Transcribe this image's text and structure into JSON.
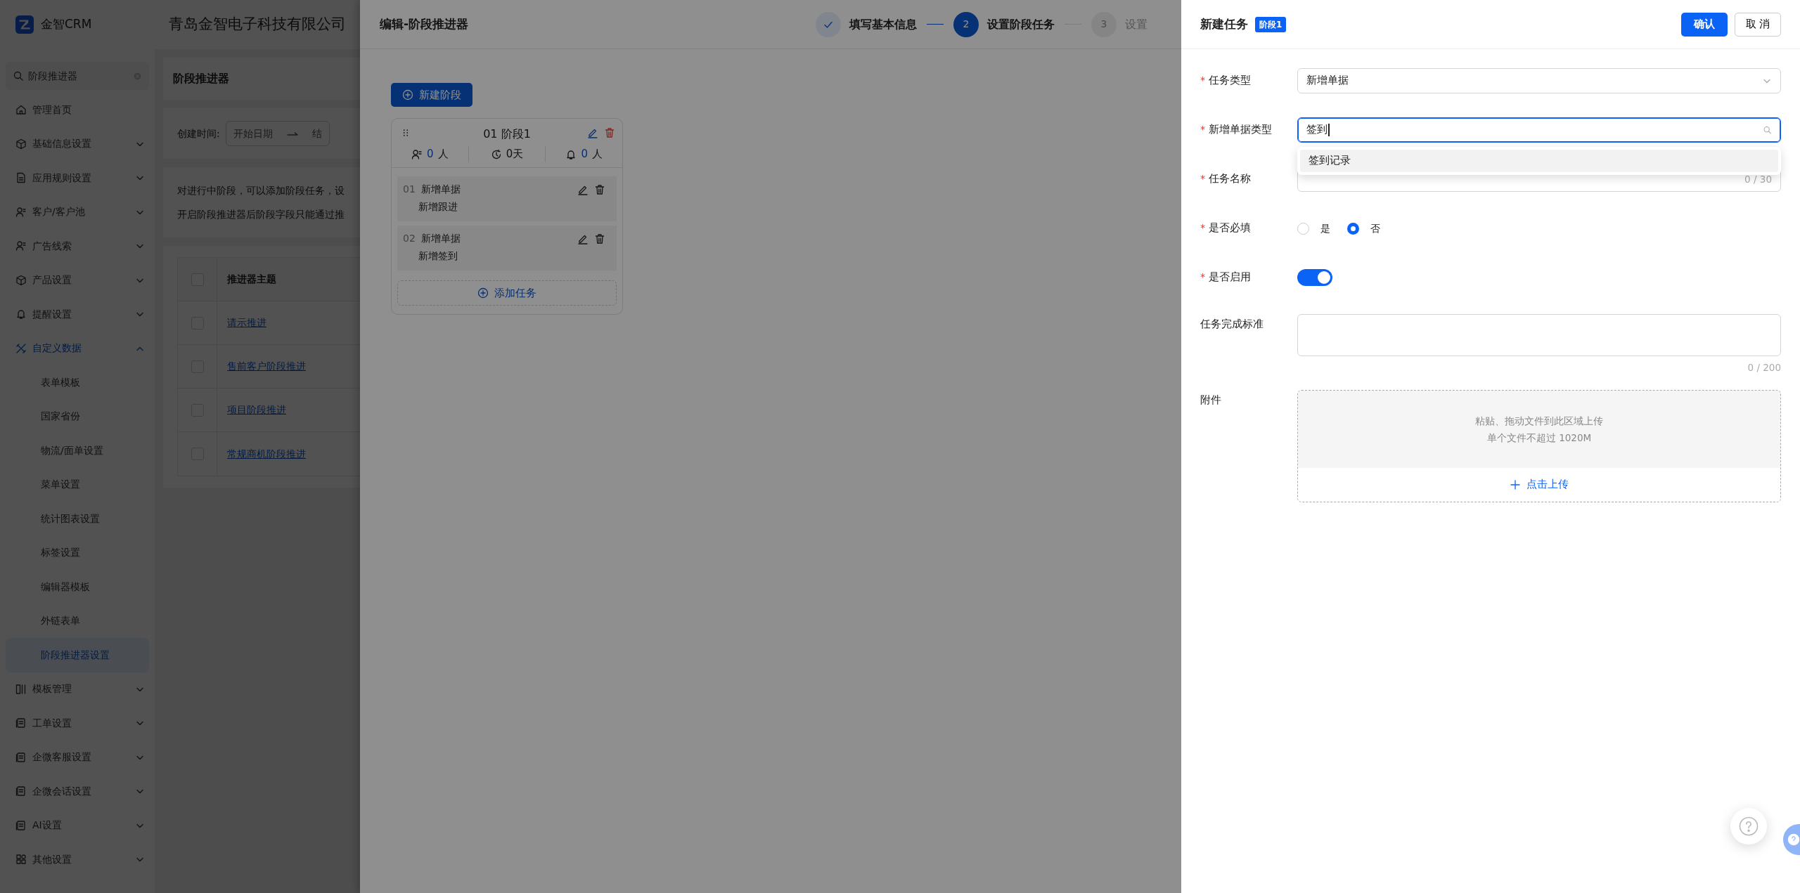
{
  "app": {
    "logo": "金智CRM",
    "company": "青岛金智电子科技有限公司"
  },
  "sidebar": {
    "search": {
      "value": "阶段推进器"
    },
    "items": [
      {
        "label": "管理首页",
        "kind": "link",
        "expanded": false,
        "selected": false
      },
      {
        "label": "基础信息设置",
        "kind": "group",
        "expanded": false,
        "selected": false
      },
      {
        "label": "应用规则设置",
        "kind": "group",
        "expanded": false,
        "selected": false
      },
      {
        "label": "客户/客户池",
        "kind": "group",
        "expanded": false,
        "selected": false
      },
      {
        "label": "广告线索",
        "kind": "group",
        "expanded": false,
        "selected": false
      },
      {
        "label": "产品设置",
        "kind": "group",
        "expanded": false,
        "selected": false
      },
      {
        "label": "提醒设置",
        "kind": "group",
        "expanded": false,
        "selected": false
      },
      {
        "label": "自定义数据",
        "kind": "group",
        "expanded": true,
        "selected": false,
        "children": [
          {
            "label": "表单模板",
            "selected": false
          },
          {
            "label": "国家省份",
            "selected": false
          },
          {
            "label": "物流/面单设置",
            "selected": false
          },
          {
            "label": "菜单设置",
            "selected": false
          },
          {
            "label": "统计图表设置",
            "selected": false
          },
          {
            "label": "标签设置",
            "selected": false
          },
          {
            "label": "编辑器模板",
            "selected": false
          },
          {
            "label": "外链表单",
            "selected": false
          },
          {
            "label": "阶段推进器设置",
            "selected": true
          }
        ]
      },
      {
        "label": "模板管理",
        "kind": "group",
        "expanded": false,
        "selected": false
      },
      {
        "label": "工单设置",
        "kind": "group",
        "expanded": false,
        "selected": false
      },
      {
        "label": "企微客服设置",
        "kind": "group",
        "expanded": false,
        "selected": false
      },
      {
        "label": "企微会话设置",
        "kind": "group",
        "expanded": false,
        "selected": false
      },
      {
        "label": "AI设置",
        "kind": "group",
        "expanded": false,
        "selected": false
      },
      {
        "label": "其他设置",
        "kind": "group",
        "expanded": false,
        "selected": false
      }
    ]
  },
  "page": {
    "title": "阶段推进器",
    "filter": {
      "label": "创建时间:",
      "start_placeholder": "开始日期",
      "end_placeholder": "结"
    },
    "notes": [
      "对进行中阶段，可以添加阶段任务，设",
      "开启阶段推进器后阶段字段只能通过推"
    ],
    "table": {
      "columns": [
        "推进器主题"
      ],
      "header_checked": false,
      "rows": [
        {
          "name": "请示推进",
          "checked": false
        },
        {
          "name": "售前客户阶段推进",
          "checked": false
        },
        {
          "name": "项目阶段推进",
          "checked": false
        },
        {
          "name": "常规商机阶段推进",
          "checked": false
        }
      ]
    }
  },
  "dialog": {
    "title": "编辑-阶段推进器",
    "steps": [
      {
        "label": "填写基本信息",
        "done": true,
        "selected": false
      },
      {
        "number": "2",
        "label": "设置阶段任务",
        "done": false,
        "selected": true
      },
      {
        "number": "3",
        "label": "设置",
        "done": false,
        "selected": false
      }
    ],
    "add_stage_button": "新建阶段",
    "stages": [
      {
        "title": "01 阶段1",
        "owners": "0",
        "owners_unit": "人",
        "days": "0天",
        "reminders": "0",
        "reminders_unit": "人",
        "tasks": [
          {
            "number": "01",
            "type": "新增单据",
            "name": "新增跟进"
          },
          {
            "number": "02",
            "type": "新增单据",
            "name": "新增签到"
          }
        ],
        "add_task_button": "添加任务"
      }
    ]
  },
  "drawer": {
    "title": "新建任务",
    "badge": "阶段1",
    "confirm_button": "确认",
    "cancel_button": "取 消",
    "fields": [
      {
        "kind": "select",
        "required_mark": "*",
        "label": "任务类型",
        "value": "新增单据"
      },
      {
        "kind": "search",
        "required_mark": "*",
        "label": "新增单据类型",
        "value": "签到",
        "options": [
          {
            "label": "签到记录",
            "active": true
          }
        ]
      },
      {
        "kind": "text",
        "required_mark": "*",
        "label": "任务名称",
        "counter": "0 / 30"
      },
      {
        "kind": "radio",
        "required_mark": "*",
        "label": "是否必填",
        "options": [
          {
            "label": "是",
            "selected": false
          },
          {
            "label": "否",
            "selected": true
          }
        ]
      },
      {
        "kind": "switch",
        "required_mark": "*",
        "label": "是否启用",
        "on": true
      },
      {
        "kind": "textarea",
        "label": "任务完成标准",
        "counter": "0 / 200"
      },
      {
        "kind": "upload",
        "label": "附件",
        "hint": "粘贴、拖动文件到此区域上传",
        "limit": "单个文件不超过 1020M",
        "button": "点击上传"
      }
    ]
  }
}
